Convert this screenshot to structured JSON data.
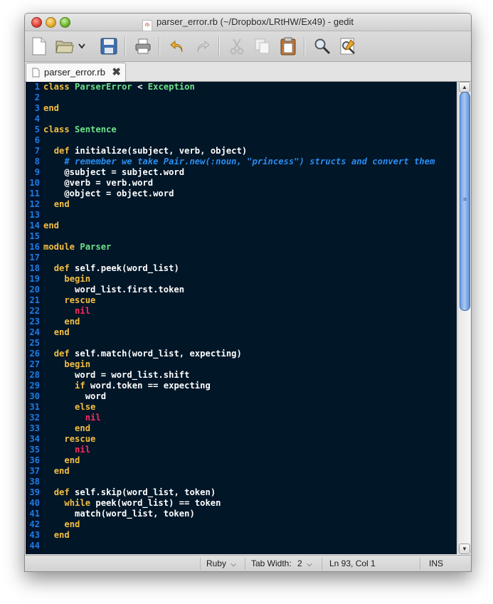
{
  "window": {
    "title": "parser_error.rb (~/Dropbox/LRtHW/Ex49) - gedit",
    "file_badge": "rb"
  },
  "toolbar": {
    "buttons": [
      "new-document-icon",
      "open-folder-icon",
      "open-dropdown-icon",
      "save-icon",
      "print-icon",
      "undo-icon",
      "redo-icon",
      "cut-icon",
      "copy-icon",
      "paste-icon",
      "find-icon",
      "find-replace-icon"
    ]
  },
  "tabs": [
    {
      "label": "parser_error.rb"
    }
  ],
  "colors": {
    "editor_background": "#011627",
    "line_number": "#1f7ce0",
    "keyword": "#f3be42",
    "class_name": "#6fe28a",
    "nil": "#ff2860",
    "comment": "#2a8cf0",
    "scroll_thumb": "#6c9fe3"
  },
  "editor": {
    "lines": [
      {
        "n": "1",
        "code": "class ParserError < Exception"
      },
      {
        "n": "2",
        "code": ""
      },
      {
        "n": "3",
        "code": "end"
      },
      {
        "n": "4",
        "code": ""
      },
      {
        "n": "5",
        "code": "class Sentence"
      },
      {
        "n": "6",
        "code": ""
      },
      {
        "n": "7",
        "code": "  def initialize(subject, verb, object)"
      },
      {
        "n": "8",
        "code": "    # remember we take Pair.new(:noun, \"princess\") structs and convert them"
      },
      {
        "n": "9",
        "code": "    @subject = subject.word"
      },
      {
        "n": "10",
        "code": "    @verb = verb.word"
      },
      {
        "n": "11",
        "code": "    @object = object.word"
      },
      {
        "n": "12",
        "code": "  end"
      },
      {
        "n": "13",
        "code": ""
      },
      {
        "n": "14",
        "code": "end"
      },
      {
        "n": "15",
        "code": ""
      },
      {
        "n": "16",
        "code": "module Parser"
      },
      {
        "n": "17",
        "code": ""
      },
      {
        "n": "18",
        "code": "  def self.peek(word_list)"
      },
      {
        "n": "19",
        "code": "    begin"
      },
      {
        "n": "20",
        "code": "      word_list.first.token"
      },
      {
        "n": "21",
        "code": "    rescue"
      },
      {
        "n": "22",
        "code": "      nil"
      },
      {
        "n": "23",
        "code": "    end"
      },
      {
        "n": "24",
        "code": "  end"
      },
      {
        "n": "25",
        "code": ""
      },
      {
        "n": "26",
        "code": "  def self.match(word_list, expecting)"
      },
      {
        "n": "27",
        "code": "    begin"
      },
      {
        "n": "28",
        "code": "      word = word_list.shift"
      },
      {
        "n": "29",
        "code": "      if word.token == expecting"
      },
      {
        "n": "30",
        "code": "        word"
      },
      {
        "n": "31",
        "code": "      else"
      },
      {
        "n": "32",
        "code": "        nil"
      },
      {
        "n": "33",
        "code": "      end"
      },
      {
        "n": "34",
        "code": "    rescue"
      },
      {
        "n": "35",
        "code": "      nil"
      },
      {
        "n": "36",
        "code": "    end"
      },
      {
        "n": "37",
        "code": "  end"
      },
      {
        "n": "38",
        "code": ""
      },
      {
        "n": "39",
        "code": "  def self.skip(word_list, token)"
      },
      {
        "n": "40",
        "code": "    while peek(word_list) == token"
      },
      {
        "n": "41",
        "code": "      match(word_list, token)"
      },
      {
        "n": "42",
        "code": "    end"
      },
      {
        "n": "43",
        "code": "  end"
      },
      {
        "n": "44",
        "code": ""
      }
    ]
  },
  "scrollbar": {
    "up_arrow": "▲",
    "down_arrow": "▼",
    "grip": "≡"
  },
  "status": {
    "language": "Ruby",
    "tab_width_label": "Tab Width:",
    "tab_width_value": "2",
    "position": "Ln 93, Col 1",
    "mode": "INS"
  }
}
